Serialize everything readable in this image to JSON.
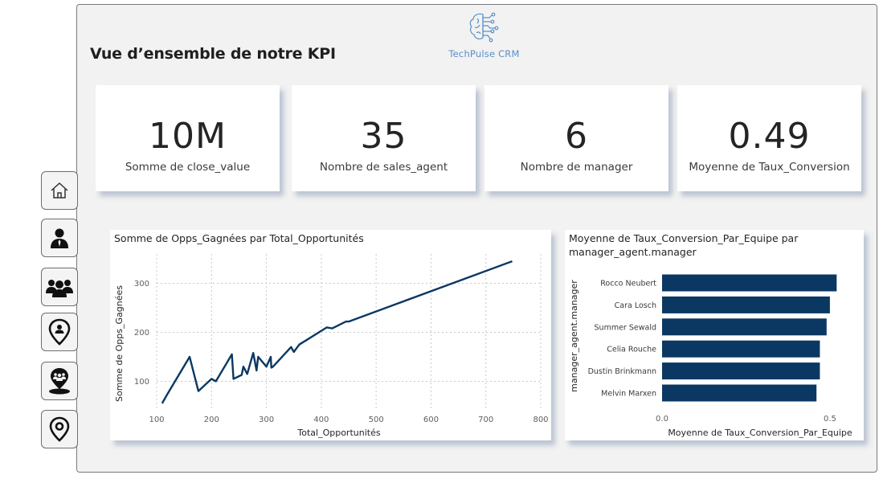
{
  "header": {
    "title": "Vue d’ensemble de notre KPI",
    "logo_text": "TechPulse CRM"
  },
  "kpis": [
    {
      "value": "10M",
      "label": "Somme de close_value"
    },
    {
      "value": "35",
      "label": "Nombre de sales_agent"
    },
    {
      "value": "6",
      "label": "Nombre de manager"
    },
    {
      "value": "0.49",
      "label": "Moyenne de Taux_Conversion"
    }
  ],
  "nav": [
    {
      "icon": "home-icon"
    },
    {
      "icon": "person-icon"
    },
    {
      "icon": "team-icon"
    },
    {
      "icon": "location-person-icon"
    },
    {
      "icon": "location-team-icon"
    },
    {
      "icon": "location-pin-icon"
    }
  ],
  "colors": {
    "series": "#0b3863",
    "grid": "#c8c8c8",
    "panel": "#f2f2f2"
  },
  "chart_data": [
    {
      "type": "line",
      "title": "Somme de Opps_Gagnées par Total_Opportunités",
      "xlabel": "Total_Opportunités",
      "ylabel": "Somme de Opps_Gagnées",
      "xlim": [
        100,
        800
      ],
      "ylim": [
        40,
        360
      ],
      "xticks": [
        100,
        200,
        300,
        400,
        500,
        600,
        700,
        800
      ],
      "yticks": [
        100,
        200,
        300
      ],
      "grid": true,
      "series": [
        {
          "x": [
            110,
            120,
            160,
            176,
            200,
            208,
            237,
            240,
            255,
            258,
            265,
            276,
            282,
            285,
            300,
            308,
            309,
            312,
            345,
            350,
            360,
            410,
            420,
            445,
            450,
            748
          ],
          "y": [
            55,
            75,
            150,
            80,
            105,
            100,
            155,
            105,
            113,
            130,
            115,
            158,
            122,
            150,
            130,
            150,
            128,
            130,
            170,
            160,
            175,
            210,
            208,
            222,
            222,
            345
          ]
        }
      ]
    },
    {
      "type": "bar",
      "orientation": "horizontal",
      "title": "Moyenne de Taux_Conversion_Par_Equipe par manager_agent.manager",
      "title_lines": [
        "Moyenne de Taux_Conversion_Par_Equipe par",
        "manager_agent.manager"
      ],
      "xlabel": "Moyenne de Taux_Conversion_Par_Equipe",
      "ylabel": "manager_agent.manager",
      "xlim": [
        0,
        0.56
      ],
      "xticks": [
        0.0,
        0.5
      ],
      "xtick_labels": [
        "0.0",
        "0.5"
      ],
      "categories": [
        "Rocco Neubert",
        "Cara Losch",
        "Summer Sewald",
        "Celia Rouche",
        "Dustin Brinkmann",
        "Melvin Marxen"
      ],
      "values": [
        0.52,
        0.5,
        0.49,
        0.47,
        0.47,
        0.46
      ]
    }
  ]
}
